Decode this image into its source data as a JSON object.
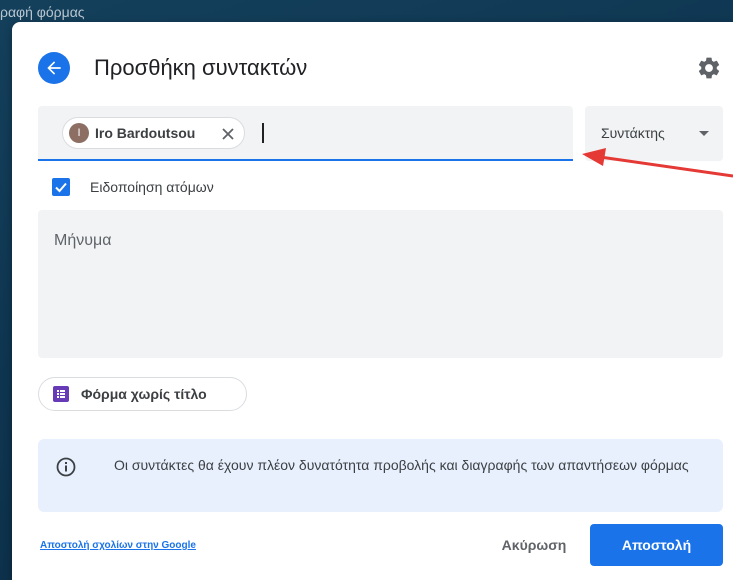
{
  "background": {
    "partial_title": "ραφή φόρμας"
  },
  "dialog": {
    "title": "Προσθήκη συντακτών",
    "recipients": [
      {
        "initial": "I",
        "name": "Iro Bardoutsou"
      }
    ],
    "role_select": {
      "selected": "Συντάκτης"
    },
    "notify": {
      "label": "Ειδοποίηση ατόμων",
      "checked": true
    },
    "message": {
      "placeholder": "Μήνυμα"
    },
    "form_chip": {
      "label": "Φόρμα χωρίς τίτλο"
    },
    "info": {
      "text": "Οι συντάκτες θα έχουν πλέον δυνατότητα προβολής και διαγραφής των απαντήσεων φόρμας"
    },
    "footer": {
      "feedback_link": "Αποστολή σχολίων στην Google",
      "cancel_label": "Ακύρωση",
      "send_label": "Αποστολή"
    }
  },
  "icons": {
    "back": "arrow-back-icon",
    "settings": "gear-icon",
    "chip_close": "close-icon",
    "checkbox": "check-icon",
    "form": "form-list-icon",
    "info": "info-icon"
  },
  "colors": {
    "accent": "#1a73e8",
    "form_purple": "#673ab7",
    "info_bg": "#e8f0fe",
    "avatar": "#8d6e63",
    "annotation_arrow": "#e53935"
  }
}
